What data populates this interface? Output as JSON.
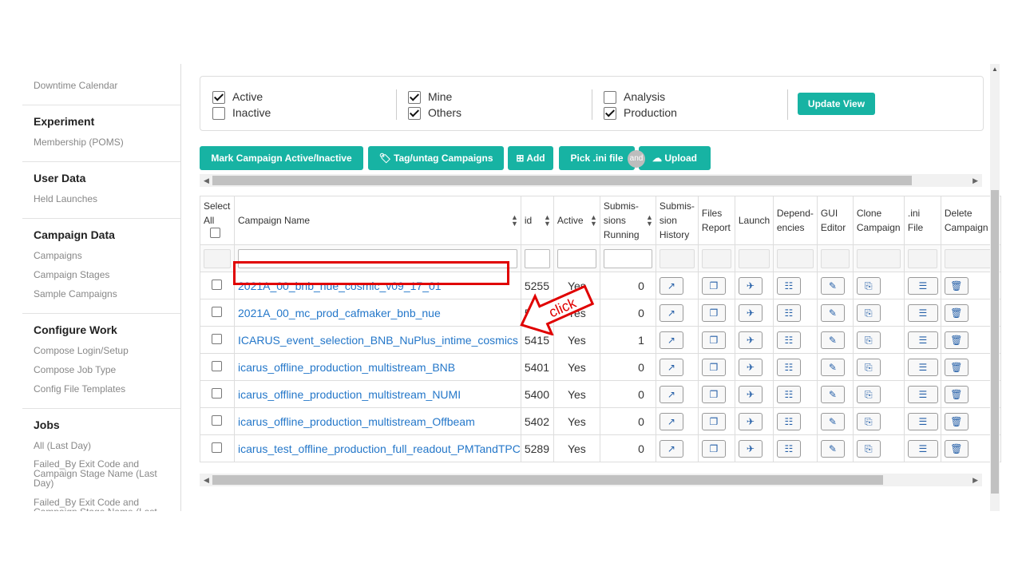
{
  "sidebar": {
    "top_item": "Downtime Calendar",
    "sections": [
      {
        "title": "Experiment",
        "items": [
          "Membership (POMS)"
        ]
      },
      {
        "title": "User Data",
        "items": [
          "Held Launches"
        ]
      },
      {
        "title": "Campaign Data",
        "items": [
          "Campaigns",
          "Campaign Stages",
          "Sample Campaigns"
        ]
      },
      {
        "title": "Configure Work",
        "items": [
          "Compose Login/Setup",
          "Compose Job Type",
          "Config File Templates"
        ]
      },
      {
        "title": "Jobs",
        "items": [
          "All (Last Day)",
          "Failed_By Exit Code and Campaign Stage Name (Last Day)",
          "Failed_By Exit Code and Campaign Stage Name (Last"
        ]
      }
    ]
  },
  "filters": {
    "active": {
      "label": "Active",
      "checked": true
    },
    "inactive": {
      "label": "Inactive",
      "checked": false
    },
    "mine": {
      "label": "Mine",
      "checked": true
    },
    "others": {
      "label": "Others",
      "checked": true
    },
    "analysis": {
      "label": "Analysis",
      "checked": false
    },
    "production": {
      "label": "Production",
      "checked": true
    },
    "update_button": "Update View"
  },
  "toolbar": {
    "mark_active": "Mark Campaign Active/Inactive",
    "tag": "Tag/untag Campaigns",
    "add": "Add",
    "pick_ini": "Pick .ini file",
    "and_badge": "and",
    "upload": "Upload"
  },
  "table": {
    "headers": {
      "select_all": "Select All",
      "campaign_name": "Campaign Name",
      "id": "id",
      "active": "Active",
      "submissions_running": "Submis- sions Running",
      "submission_history": "Submis- sion History",
      "files_report": "Files Report",
      "launch": "Launch",
      "dependencies": "Depend- encies",
      "gui_editor": "GUI Editor",
      "clone_campaign": "Clone Campaign",
      "ini_file": ".ini File",
      "delete_campaign": "Delete Campaign"
    },
    "rows": [
      {
        "name": "2021A_00_bnb_nue_cosmic_v09_17_01",
        "id": "5255",
        "active": "Yes",
        "running": "0"
      },
      {
        "name": "2021A_00_mc_prod_cafmaker_bnb_nue",
        "id": "5348",
        "active": "Yes",
        "running": "0"
      },
      {
        "name": "ICARUS_event_selection_BNB_NuPlus_intime_cosmics",
        "id": "5415",
        "active": "Yes",
        "running": "1"
      },
      {
        "name": "icarus_offline_production_multistream_BNB",
        "id": "5401",
        "active": "Yes",
        "running": "0"
      },
      {
        "name": "icarus_offline_production_multistream_NUMI",
        "id": "5400",
        "active": "Yes",
        "running": "0"
      },
      {
        "name": "icarus_offline_production_multistream_Offbeam",
        "id": "5402",
        "active": "Yes",
        "running": "0"
      },
      {
        "name": "icarus_test_offline_production_full_readout_PMTandTPC",
        "id": "5289",
        "active": "Yes",
        "running": "0"
      }
    ]
  },
  "annotation": {
    "label": "click",
    "color": "#e00000"
  },
  "colors": {
    "accent": "#17b3a3",
    "link": "#2477c9",
    "highlight": "#e00000"
  }
}
